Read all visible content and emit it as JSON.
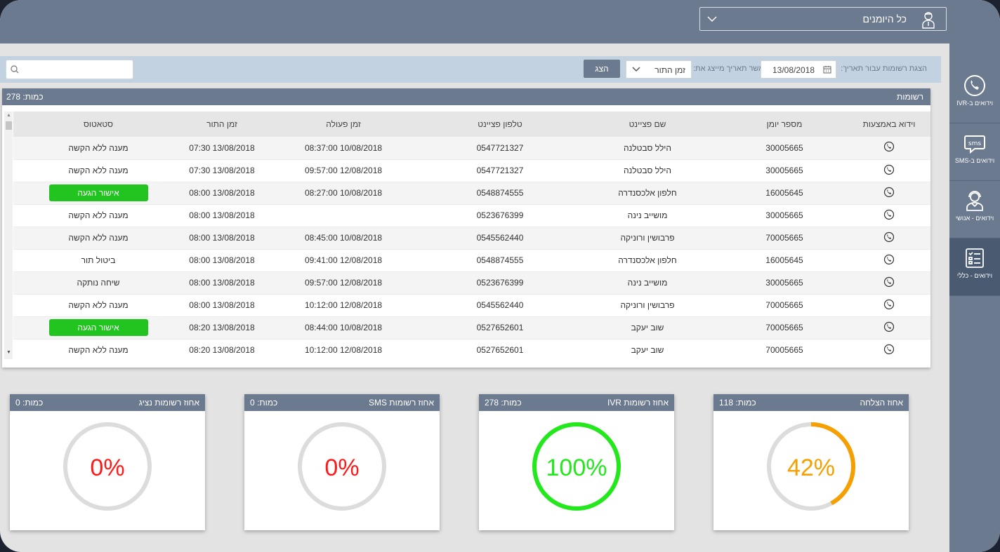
{
  "header": {
    "journal_select": "כל היומנים"
  },
  "sidebar": {
    "items": [
      {
        "label": "וידואים ב-IVR",
        "icon": "phone-icon"
      },
      {
        "label": "וידואים ב-SMS",
        "icon": "sms-icon"
      },
      {
        "label": "וידואים - אנושי",
        "icon": "agent-icon"
      },
      {
        "label": "וידואים - כללי",
        "icon": "checklist-icon"
      }
    ],
    "active_index": 3
  },
  "filter": {
    "label_show_records": "הצגת רשומות עבור תאריך:",
    "date": "13/08/2018",
    "label_date_field": "כאשר תאריך מייצג את:",
    "field_value": "זמן התור",
    "show_button": "הצג",
    "search_value": ""
  },
  "records": {
    "title": "רשומות",
    "count_label": "כמות: 278",
    "columns": [
      "וידוא באמצעות",
      "מספר יומן",
      "שם פציינט",
      "טלפון פציינט",
      "זמן פעולה",
      "זמן התור",
      "סטאטוס"
    ],
    "rows": [
      {
        "journal": "30005665",
        "patient": "הילל סבטלנה",
        "phone": "0547721327",
        "action_time": "08:37:00 10/08/2018",
        "appt_time": "07:30 13/08/2018",
        "status": "מענה ללא הקשה",
        "status_badge": false
      },
      {
        "journal": "30005665",
        "patient": "הילל סבטלנה",
        "phone": "0547721327",
        "action_time": "09:57:00 12/08/2018",
        "appt_time": "07:30 13/08/2018",
        "status": "מענה ללא הקשה",
        "status_badge": false
      },
      {
        "journal": "16005645",
        "patient": "חלפון אלכסנדרה",
        "phone": "0548874555",
        "action_time": "08:27:00 10/08/2018",
        "appt_time": "08:00 13/08/2018",
        "status": "אישור הגעה",
        "status_badge": true
      },
      {
        "journal": "30005665",
        "patient": "מושייב נינה",
        "phone": "0523676399",
        "action_time": "",
        "appt_time": "08:00 13/08/2018",
        "status": "מענה ללא הקשה",
        "status_badge": false
      },
      {
        "journal": "70005665",
        "patient": "פרבושין ורוניקה",
        "phone": "0545562440",
        "action_time": "08:45:00 10/08/2018",
        "appt_time": "08:00 13/08/2018",
        "status": "מענה ללא הקשה",
        "status_badge": false
      },
      {
        "journal": "16005645",
        "patient": "חלפון אלכסנדרה",
        "phone": "0548874555",
        "action_time": "09:41:00 12/08/2018",
        "appt_time": "08:00 13/08/2018",
        "status": "ביטול תור",
        "status_badge": false
      },
      {
        "journal": "30005665",
        "patient": "מושייב נינה",
        "phone": "0523676399",
        "action_time": "09:57:00 12/08/2018",
        "appt_time": "08:00 13/08/2018",
        "status": "שיחה נותקה",
        "status_badge": false
      },
      {
        "journal": "70005665",
        "patient": "פרבושין ורוניקה",
        "phone": "0545562440",
        "action_time": "10:12:00 12/08/2018",
        "appt_time": "08:00 13/08/2018",
        "status": "מענה ללא הקשה",
        "status_badge": false
      },
      {
        "journal": "70005665",
        "patient": "שוב יעקב",
        "phone": "0527652601",
        "action_time": "08:44:00 10/08/2018",
        "appt_time": "08:20 13/08/2018",
        "status": "אישור הגעה",
        "status_badge": true
      },
      {
        "journal": "70005665",
        "patient": "שוב יעקב",
        "phone": "0527652601",
        "action_time": "10:12:00 12/08/2018",
        "appt_time": "08:20 13/08/2018",
        "status": "מענה ללא הקשה",
        "status_badge": false
      }
    ]
  },
  "stats": [
    {
      "title": "אחוז הצלחה",
      "count": "כמות: 118",
      "percent_label": "42%",
      "fraction": 0.42,
      "color": "#f5a000"
    },
    {
      "title": "אחוז רשומות IVR",
      "count": "כמות: 278",
      "percent_label": "100%",
      "fraction": 1.0,
      "color": "#22e81c"
    },
    {
      "title": "אחוז רשומות SMS",
      "count": "כמות: 0",
      "percent_label": "0%",
      "fraction": 0.0,
      "color": "#ff1a1a"
    },
    {
      "title": "אחוז רשומות נציג",
      "count": "כמות: 0",
      "percent_label": "0%",
      "fraction": 0.0,
      "color": "#ff1a1a"
    }
  ],
  "colors": {
    "header_bg": "#6b7a8f",
    "badge_green": "#22c41f",
    "track_gray": "#dcdcdc"
  }
}
